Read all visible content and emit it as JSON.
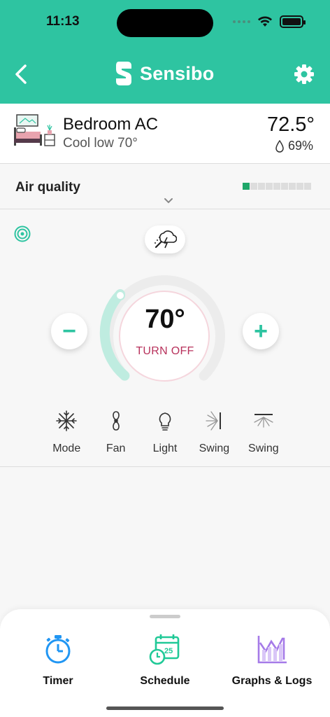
{
  "status_bar": {
    "time": "11:13"
  },
  "header": {
    "brand": "Sensibo"
  },
  "device": {
    "name": "Bedroom AC",
    "status": "Cool low 70°",
    "room_temperature": "72.5°",
    "humidity": "69%"
  },
  "air_quality": {
    "label": "Air quality",
    "level": 1,
    "segments": 9
  },
  "control": {
    "target_temperature": "70°",
    "turn_off_label": "TURN OFF",
    "minus_label": "−",
    "plus_label": "+"
  },
  "modes": [
    {
      "label": "Mode",
      "icon": "snowflake-icon"
    },
    {
      "label": "Fan",
      "icon": "fan-icon"
    },
    {
      "label": "Light",
      "icon": "lightbulb-icon"
    },
    {
      "label": "Swing",
      "icon": "horizontal-swing-icon"
    },
    {
      "label": "Swing",
      "icon": "vertical-swing-icon"
    }
  ],
  "bottom_nav": [
    {
      "label": "Timer",
      "icon": "stopwatch-icon"
    },
    {
      "label": "Schedule",
      "icon": "calendar-clock-icon",
      "badge": "25"
    },
    {
      "label": "Graphs & Logs",
      "icon": "chart-icon"
    }
  ],
  "colors": {
    "brand": "#2ec4a1",
    "turn_off": "#b8325c",
    "air_quality_good": "#1fa76a",
    "timer": "#2196f3",
    "schedule": "#20c997",
    "graphs": "#a57ae8"
  }
}
